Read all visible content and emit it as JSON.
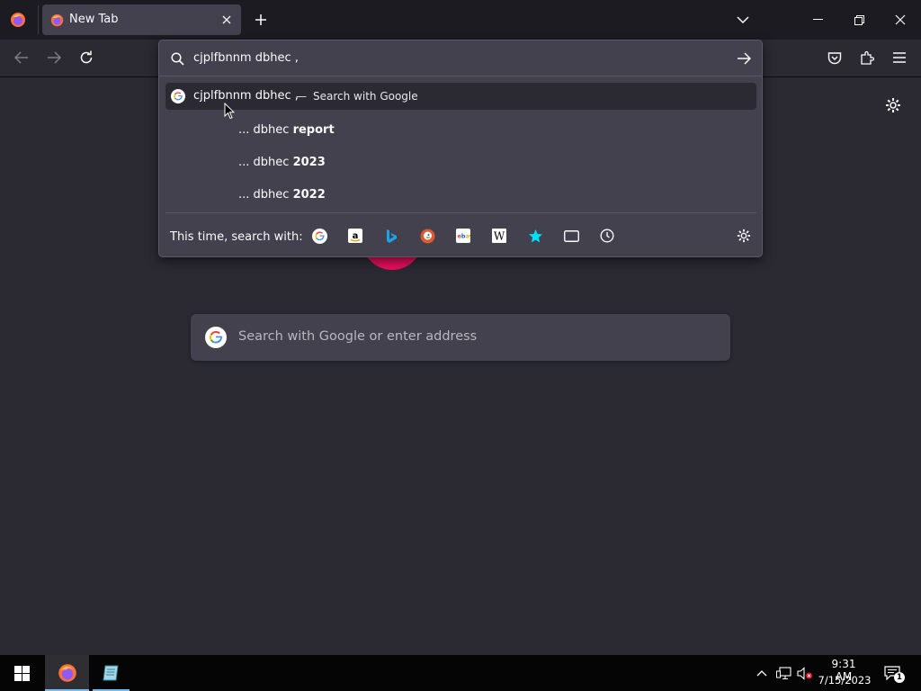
{
  "browser": {
    "tab": {
      "title": "New Tab"
    }
  },
  "urlbar": {
    "value": "cjplfbnnm dbhec ,",
    "results": [
      {
        "text": "cjplfbnnm dbhec ,",
        "separator": "—",
        "hint": "Search with Google"
      }
    ],
    "suggestions": [
      {
        "prefix": "... dbhec",
        "bold": "report"
      },
      {
        "prefix": "... dbhec",
        "bold": "2023"
      },
      {
        "prefix": "... dbhec",
        "bold": "2022"
      }
    ],
    "oneoff_label": "This time, search with:",
    "oneoff_engines": [
      "google-icon",
      "amazon-icon",
      "bing-icon",
      "duckduckgo-icon",
      "ebay-icon",
      "wikipedia-icon",
      "bookmarks-icon",
      "tabs-icon",
      "history-icon"
    ]
  },
  "newtab": {
    "search_placeholder": "Search with Google or enter address"
  },
  "taskbar": {
    "time": "9:31 AM",
    "date": "7/15/2023",
    "notification_count": "1"
  },
  "colors": {
    "accent": "#e5105c",
    "background": "#2b2a33",
    "panel": "#42414d"
  }
}
